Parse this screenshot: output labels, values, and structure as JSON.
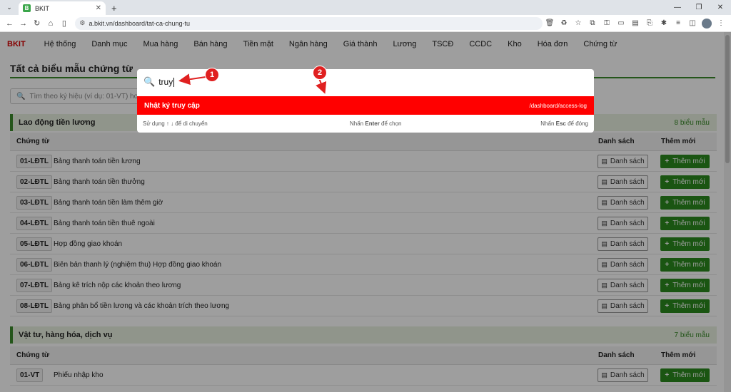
{
  "browser": {
    "tab_title": "BKIT",
    "favicon_letter": "B",
    "url": "a.bkit.vn/dashboard/tat-ca-chung-tu"
  },
  "app": {
    "brand": "BKIT",
    "nav": [
      "Hệ thống",
      "Danh mục",
      "Mua hàng",
      "Bán hàng",
      "Tiền mặt",
      "Ngân hàng",
      "Giá thành",
      "Lương",
      "TSCĐ",
      "CCDC",
      "Kho",
      "Hóa đơn",
      "Chứng từ"
    ]
  },
  "page": {
    "title": "Tất cả biểu mẫu chứng từ",
    "search_placeholder": "Tìm theo ký hiệu (ví dụ: 01-VT) hoặc"
  },
  "columns": {
    "doc": "Chứng từ",
    "list": "Danh sách",
    "add": "Thêm mới"
  },
  "buttons": {
    "list": "Danh sách",
    "add": "Thêm mới"
  },
  "sections": [
    {
      "name": "Lao động tiền lương",
      "count": "8 biểu mẫu",
      "rows": [
        {
          "code": "01-LĐTL",
          "name": "Bảng thanh toán tiền lương"
        },
        {
          "code": "02-LĐTL",
          "name": "Bảng thanh toán tiền thưởng"
        },
        {
          "code": "03-LĐTL",
          "name": "Bảng thanh toán tiền làm thêm giờ"
        },
        {
          "code": "04-LĐTL",
          "name": "Bảng thanh toán tiền thuê ngoài"
        },
        {
          "code": "05-LĐTL",
          "name": "Hợp đồng giao khoán"
        },
        {
          "code": "06-LĐTL",
          "name": "Biên bản thanh lý (nghiệm thu) Hợp đồng giao khoán"
        },
        {
          "code": "07-LĐTL",
          "name": "Bảng kê trích nộp các khoản theo lương"
        },
        {
          "code": "08-LĐTL",
          "name": "Bảng phân bổ tiền lương và các khoản trích theo lương"
        }
      ]
    },
    {
      "name": "Vật tư, hàng hóa, dịch vụ",
      "count": "7 biểu mẫu",
      "rows": [
        {
          "code": "01-VT",
          "name": "Phiếu nhập kho"
        }
      ]
    }
  ],
  "palette": {
    "query": "truy",
    "result_title": "Nhật ký truy cập",
    "result_path": "/dashboard/access-log",
    "footer_left": "Sử dụng ↑ ↓ để di chuyển",
    "footer_mid_pre": "Nhấn ",
    "footer_mid_key": "Enter",
    "footer_mid_post": " để chọn",
    "footer_right_pre": "Nhấn ",
    "footer_right_key": "Esc",
    "footer_right_post": " để đóng"
  },
  "annotations": [
    "1",
    "2"
  ],
  "colors": {
    "brand": "#d70000",
    "accent_green": "#2b8a1e",
    "result_red": "#ff0000"
  }
}
